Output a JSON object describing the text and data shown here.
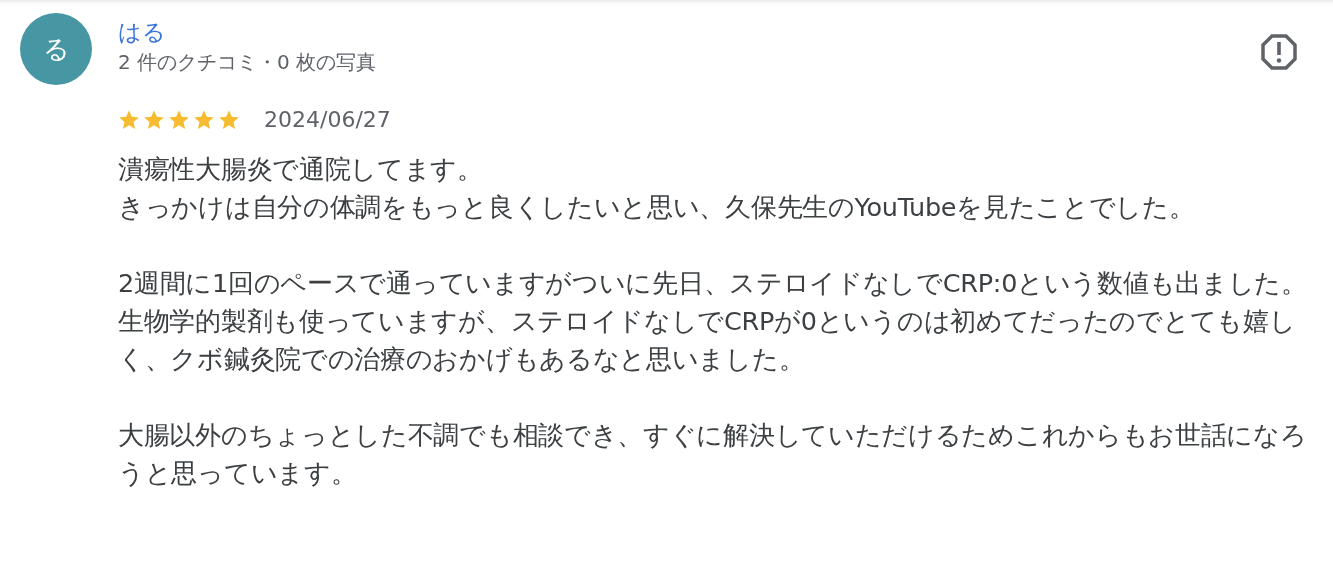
{
  "review": {
    "avatar_letter": "る",
    "reviewer": "はる",
    "meta": "2 件のクチコミ・0 枚の写真",
    "stars": 5,
    "date": "2024/06/27",
    "paragraphs": [
      [
        "潰瘍性大腸炎で通院してます。",
        "きっかけは自分の体調をもっと良くしたいと思い、久保先生のYouTubeを見たことでした。"
      ],
      [
        "2週間に1回のペースで通っていますがついに先日、ステロイドなしでCRP:0という数値も出ました。",
        "生物学的製剤も使っていますが、ステロイドなしでCRPが0というのは初めてだったのでとても嬉しく、クボ鍼灸院での治療のおかげもあるなと思いました。"
      ],
      [
        "大腸以外のちょっとした不調でも相談でき、すぐに解決していただけるためこれからもお世話になろうと思っています。"
      ]
    ]
  }
}
